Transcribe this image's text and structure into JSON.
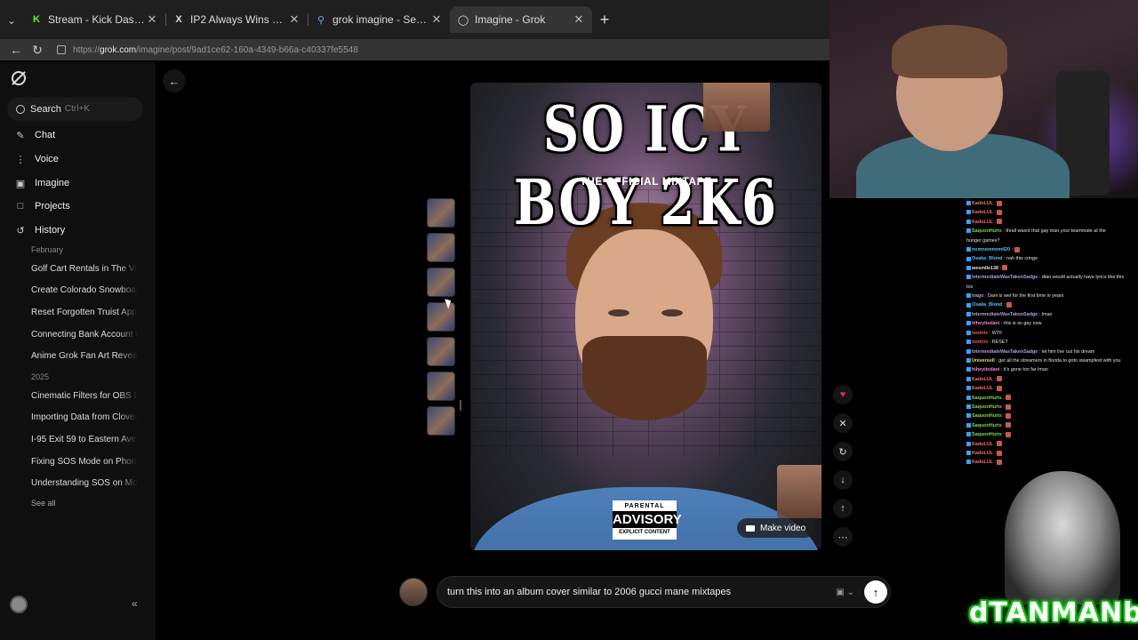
{
  "browser": {
    "tabs": [
      {
        "title": "Stream - Kick Dashboard",
        "favicon": "K",
        "active": false
      },
      {
        "title": "IP2 Always Wins on X: \"MercOffDa",
        "favicon": "X",
        "active": false
      },
      {
        "title": "grok imagine - Search",
        "favicon": "search-icon",
        "active": false
      },
      {
        "title": "Imagine - Grok",
        "favicon": "grok-icon",
        "active": true
      }
    ],
    "url_prefix": "https://",
    "url_host": "grok.com",
    "url_path": "/imagine/post/9ad1ce62-160a-4349-b66a-c40337fe5548"
  },
  "sidebar": {
    "search_label": "Search",
    "search_hint": "Ctrl+K",
    "nav": [
      {
        "label": "Chat",
        "icon": "chat-icon"
      },
      {
        "label": "Voice",
        "icon": "voice-icon"
      },
      {
        "label": "Imagine",
        "icon": "imagine-icon"
      },
      {
        "label": "Projects",
        "icon": "projects-icon"
      },
      {
        "label": "History",
        "icon": "history-icon"
      }
    ],
    "sections": [
      {
        "heading": "February",
        "items": [
          "Golf Cart Rentals in The Villa",
          "Create Colorado Snowboard",
          "Reset Forgotten Truist App",
          "Connecting Bank Account to",
          "Anime Grok Fan Art Reveal"
        ]
      },
      {
        "heading": "2025",
        "items": [
          "Cinematic Filters for OBS Li",
          "Importing Data from Clover",
          "I-95 Exit 59 to Eastern Aven",
          "Fixing SOS Mode on Phone",
          "Understanding SOS on Mob"
        ]
      }
    ],
    "see_all": "See all"
  },
  "cover": {
    "title": "SO ICY BOY 2K6",
    "subtitle": "THE OFFICIAL MIXTAPE",
    "advisory_top": "PARENTAL",
    "advisory_mid": "ADVISORY",
    "advisory_bottom": "EXPLICIT CONTENT",
    "make_video": "Make video"
  },
  "actions": [
    "heart-icon",
    "x-share-icon",
    "refresh-icon",
    "download-icon",
    "upload-icon",
    "more-icon"
  ],
  "prompt": {
    "text": "turn this into an album cover similar to 2006 gucci mane mixtapes"
  },
  "stream": {
    "chat": [
      {
        "user": "KadoLUL",
        "msg": "",
        "color": "#ff6b6b"
      },
      {
        "user": "KadoLUL",
        "msg": "",
        "color": "#ff6b6b"
      },
      {
        "user": "KadoLUL",
        "msg": "",
        "color": "#ff6b6b"
      },
      {
        "user": "SaquonHurts",
        "msg": "thrall wasnt that gay man your teammate at the",
        "color": "#7cdd45"
      },
      {
        "user": "",
        "msg": "hunger games?",
        "color": "#e0e0e0"
      },
      {
        "user": "nomnomnom420",
        "msg": "",
        "color": "#4fc3f7"
      },
      {
        "user": "Osaka_Blond",
        "msg": "nah this cringe",
        "color": "#4fc3f7"
      },
      {
        "user": "wesmile138",
        "msg": "",
        "color": "#e0e0e0"
      },
      {
        "user": "IntermediateWasTakenSadge",
        "msg": "dtan would actually have lyrics like this",
        "color": "#b39ddb"
      },
      {
        "user": "",
        "msg": "too",
        "color": "#e0e0e0"
      },
      {
        "user": "trago",
        "msg": "Dani is wet for the first time in years",
        "color": "#b39ddb"
      },
      {
        "user": "Osaka_Blond",
        "msg": "",
        "color": "#4fc3f7"
      },
      {
        "user": "IntermediateWasTakenSadge",
        "msg": "lmao",
        "color": "#b39ddb"
      },
      {
        "user": "hiheyitsdani",
        "msg": "this is so gay now",
        "color": "#ff7ad9"
      },
      {
        "user": "tonitrix",
        "msg": "WTF",
        "color": "#ff5252"
      },
      {
        "user": "tonitrix",
        "msg": "RESET",
        "color": "#ff5252"
      },
      {
        "user": "IntermediateWasTakenSadge",
        "msg": "let him live out his dream",
        "color": "#b39ddb"
      },
      {
        "user": "Universell",
        "msg": "get all the streamers in florida to goto swampfest with you",
        "color": "#ffd54f"
      },
      {
        "user": "hiheyitsdani",
        "msg": "it's gone too far lmao",
        "color": "#ff7ad9"
      },
      {
        "user": "KadoLUL",
        "msg": "",
        "color": "#ff6b6b"
      },
      {
        "user": "KadoLUL",
        "msg": "",
        "color": "#ff6b6b"
      },
      {
        "user": "SaquonHurts",
        "msg": "",
        "color": "#7cdd45"
      },
      {
        "user": "SaquonHurts",
        "msg": "",
        "color": "#7cdd45"
      },
      {
        "user": "SaquonHurts",
        "msg": "",
        "color": "#7cdd45"
      },
      {
        "user": "SaquonHurts",
        "msg": "",
        "color": "#7cdd45"
      },
      {
        "user": "SaquonHurts",
        "msg": "",
        "color": "#7cdd45"
      },
      {
        "user": "KadoLUL",
        "msg": "",
        "color": "#ff6b6b"
      },
      {
        "user": "KadoLUL",
        "msg": "",
        "color": "#ff6b6b"
      },
      {
        "user": "KadoLUL",
        "msg": "",
        "color": "#ff6b6b"
      }
    ],
    "streamer_name": "dTANMANb"
  }
}
